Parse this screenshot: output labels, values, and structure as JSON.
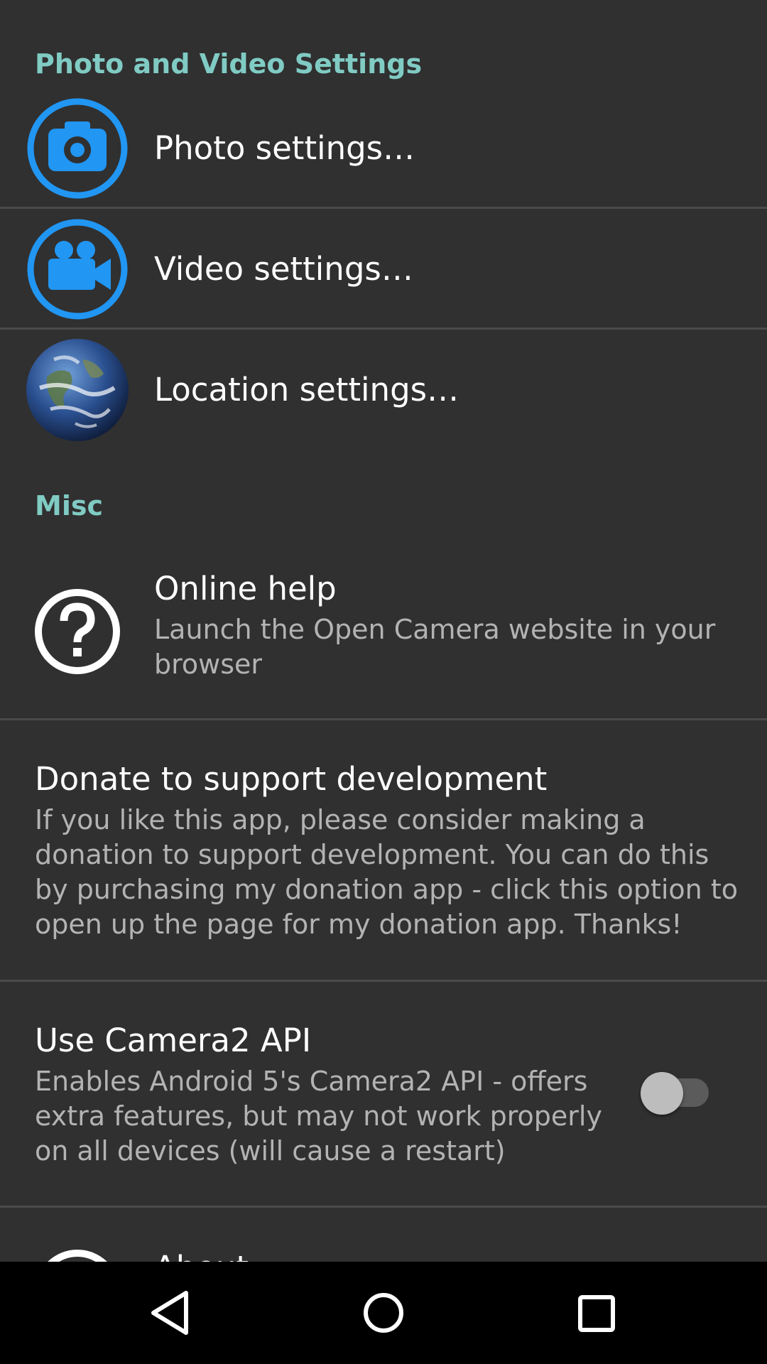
{
  "sections": {
    "photo_video_header": "Photo and Video Settings",
    "misc_header": "Misc"
  },
  "items": {
    "photo": {
      "title": "Photo settings…",
      "icon": "camera-icon"
    },
    "video": {
      "title": "Video settings…",
      "icon": "video-camera-icon"
    },
    "location": {
      "title": "Location settings…",
      "icon": "globe-icon"
    },
    "online_help": {
      "title": "Online help",
      "summary": "Launch the Open Camera website in your browser",
      "icon": "help-circle-icon"
    },
    "donate": {
      "title": "Donate to support development",
      "summary": "If you like this app, please consider making a donation to support development. You can do this by purchasing my donation app - click this option to open up the page for my donation app. Thanks!"
    },
    "camera2": {
      "title": "Use Camera2 API",
      "summary": "Enables Android 5's Camera2 API - offers extra features, but may not work properly on all devices (will cause a restart)",
      "checked": false
    },
    "about": {
      "title": "About",
      "icon": "info-icon"
    }
  },
  "colors": {
    "accent_header": "#80cbc4",
    "icon_blue": "#2196f3",
    "background": "#303030"
  },
  "navbar": {
    "back": "back-icon",
    "home": "home-icon",
    "recents": "recents-icon"
  }
}
